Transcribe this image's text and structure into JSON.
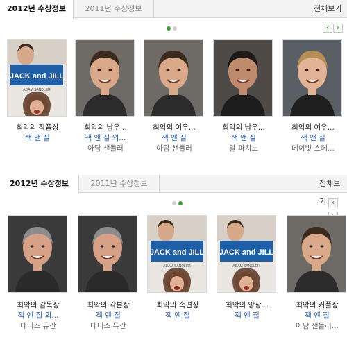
{
  "panels": [
    {
      "tabs": [
        {
          "label": "2012년 수상정보",
          "active": true
        },
        {
          "label": "2011년 수상정보",
          "active": false
        }
      ],
      "see_all": "전체보기",
      "pager": {
        "count": 2,
        "current": 1
      },
      "arrows": {
        "prev": "‹",
        "next": "›"
      },
      "items": [
        {
          "award": "최악의 작품상",
          "title": "잭 앤 질",
          "person": "",
          "image": "jack-and-jill-poster"
        },
        {
          "award": "최악의 남우...",
          "title": "잭 앤 질 외...",
          "person": "아담 샌들러",
          "image": "adam-sandler-portrait"
        },
        {
          "award": "최악의 여우...",
          "title": "잭 앤 질",
          "person": "아담 샌들러",
          "image": "adam-sandler-portrait"
        },
        {
          "award": "최악의 남우...",
          "title": "잭 앤 질",
          "person": "알 파치노",
          "image": "al-pacino-portrait"
        },
        {
          "award": "최악의 여우...",
          "title": "잭 앤 질",
          "person": "데이빗 스페...",
          "image": "david-spade-portrait"
        }
      ]
    },
    {
      "tabs": [
        {
          "label": "2012년 수상정보",
          "active": true
        },
        {
          "label": "2011년 수상정보",
          "active": false
        }
      ],
      "see_all": "전체보기",
      "pager": {
        "count": 2,
        "current": 2
      },
      "arrows": {
        "prev": "‹",
        "next": "›"
      },
      "items": [
        {
          "award": "최악의 감독상",
          "title": "잭 앤 질 외...",
          "person": "데니스 듀간",
          "image": "dennis-dugan-portrait"
        },
        {
          "award": "최악의 각본상",
          "title": "잭 앤 질",
          "person": "데니스 듀간",
          "image": "dennis-dugan-portrait"
        },
        {
          "award": "최악의 속편상",
          "title": "잭 앤 질",
          "person": "",
          "image": "jack-and-jill-poster"
        },
        {
          "award": "최악의 앙상...",
          "title": "잭 앤 질",
          "person": "",
          "image": "jack-and-jill-poster"
        },
        {
          "award": "최악의 커플상",
          "title": "잭 앤 질",
          "person": "아담 샌들러...",
          "image": "adam-sandler-portrait"
        }
      ]
    }
  ],
  "poster_text": {
    "logo": "JACK and JILL",
    "tagline": "ADAM SANDLER"
  },
  "colors": {
    "accent": "#3aa12f",
    "link": "#2a5db0",
    "poster_blue": "#1f5fa8"
  }
}
